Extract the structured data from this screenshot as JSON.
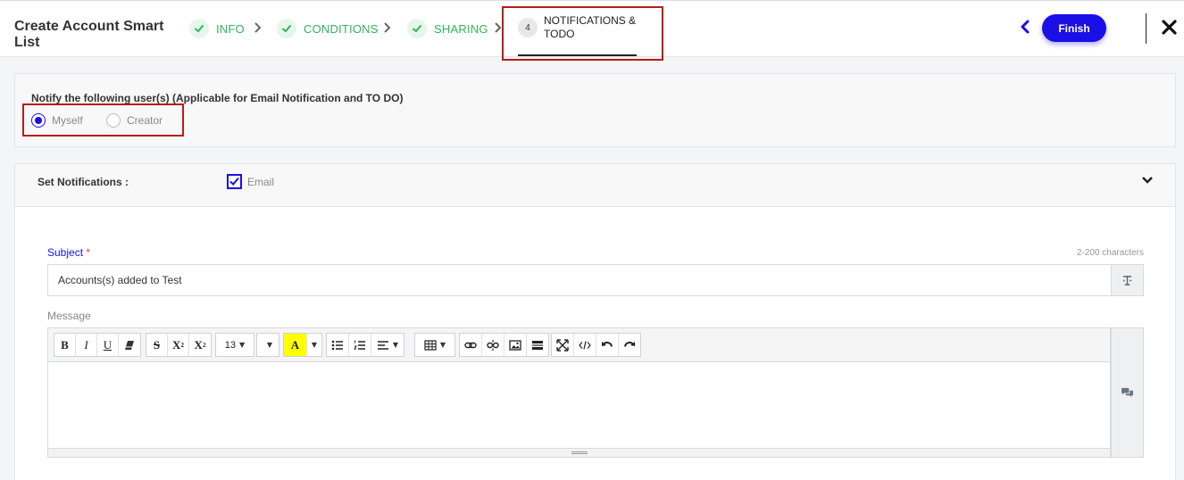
{
  "header": {
    "title": "Create Account Smart List",
    "steps": [
      {
        "label": "INFO",
        "state": "done"
      },
      {
        "label": "CONDITIONS",
        "state": "done"
      },
      {
        "label": "SHARING",
        "state": "done"
      },
      {
        "number": "4",
        "label": "NOTIFICATIONS & TODO",
        "state": "active"
      }
    ],
    "finish_label": "Finish",
    "back_icon": "chevron-left-icon",
    "close_icon": "close-icon"
  },
  "notify": {
    "label": "Notify the following user(s) (Applicable for Email Notification and TO DO)",
    "options": [
      {
        "label": "Myself",
        "selected": true
      },
      {
        "label": "Creator",
        "selected": false
      }
    ]
  },
  "notifications": {
    "label": "Set Notifications :",
    "email_label": "Email",
    "email_checked": true,
    "subject_label": "Subject",
    "required_mark": "*",
    "char_hint": "2-200 characters",
    "subject_value": "Accounts(s) added to Test",
    "message_label": "Message",
    "toolbar": {
      "bold": "B",
      "italic": "I",
      "underline": "U",
      "strikethrough": "S",
      "superscript": "X",
      "superscript_mark": "2",
      "subscript": "X",
      "subscript_mark": "2",
      "font_size": "13",
      "highlight": "A"
    }
  },
  "colors": {
    "accent": "#1a10e6",
    "done_green": "#2fb45a",
    "highlight_box": "#b71c1c",
    "required": "#e53935"
  }
}
